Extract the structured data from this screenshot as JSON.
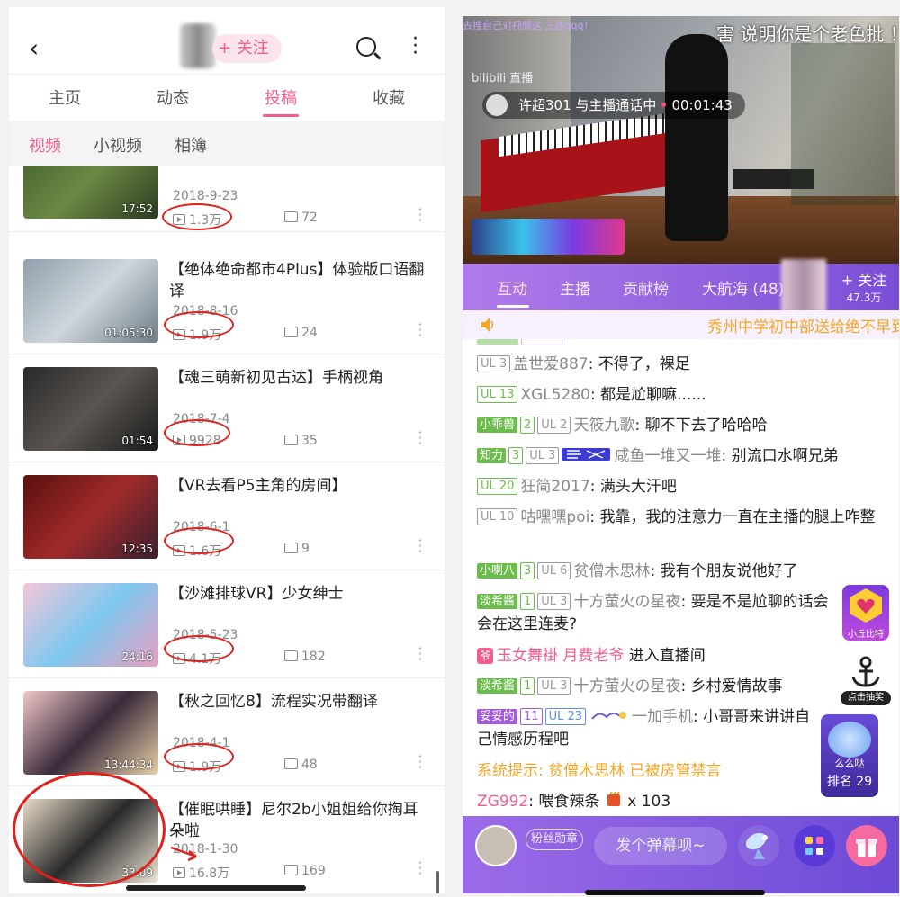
{
  "left": {
    "header": {
      "back": "‹",
      "follow": "+ 关注"
    },
    "tabs": [
      "主页",
      "动态",
      "投稿",
      "收藏"
    ],
    "active_tab": "投稿",
    "subtabs": [
      "视频",
      "小视频",
      "相簿"
    ],
    "active_subtab": "视频",
    "videos": [
      {
        "title": "",
        "date": "2018-9-23",
        "plays": "1.3万",
        "comments": "72",
        "duration": "17:52"
      },
      {
        "title": "【绝体绝命都市4Plus】体验版口语翻译",
        "date": "2018-8-16",
        "plays": "1.9万",
        "comments": "24",
        "duration": "01:05:30"
      },
      {
        "title": "【魂三萌新初见古达】手柄视角",
        "date": "2018-7-4",
        "plays": "9928",
        "comments": "35",
        "duration": "01:54"
      },
      {
        "title": "【VR去看P5主角的房间】",
        "date": "2018-6-1",
        "plays": "1.6万",
        "comments": "9",
        "duration": "12:35"
      },
      {
        "title": "【沙滩排球VR】少女绅士",
        "date": "2018-5-23",
        "plays": "4.1万",
        "comments": "182",
        "duration": "24:16"
      },
      {
        "title": "【秋之回忆8】流程实况带翻译",
        "date": "2018-4-1",
        "plays": "1.9万",
        "comments": "48",
        "duration": "13:44:34"
      },
      {
        "title": "【催眠哄睡】尼尔2b小姐姐给你掏耳朵啦",
        "date": "2018-1-30",
        "plays": "16.8万",
        "comments": "169",
        "duration": "33:09"
      }
    ]
  },
  "right": {
    "video": {
      "top_comment": "害 说明你是个老色批 ！",
      "top_scroll": "去搜自己对视频这 三连qqq！",
      "logo": "bilibili 直播",
      "call_name": "许超301",
      "call_text": "与主播通话中",
      "call_time": "00:01:43"
    },
    "tabs": [
      "互动",
      "主播",
      "贡献榜",
      "大航海 (48)"
    ],
    "active_tab": "互动",
    "follow": {
      "label": "+ 关注",
      "count": "47.3万"
    },
    "notice": "秀州中学初中部送给绝不早到",
    "chat": [
      {
        "tags": [
          {
            "t": "UL 3",
            "c": "ul"
          }
        ],
        "user": "盖世爱887",
        "msg": "不得了，裸足"
      },
      {
        "tags": [
          {
            "t": "UL 13",
            "c": "medal-n"
          }
        ],
        "user": "XGL5280",
        "msg": "都是尬聊嘛......"
      },
      {
        "tags": [
          {
            "t": "小乖兽",
            "c": "medal-g"
          },
          {
            "t": "2",
            "c": "medal-n"
          },
          {
            "t": "UL 2",
            "c": "ul"
          }
        ],
        "user": "天筱九歌",
        "msg": "聊不下去了哈哈哈"
      },
      {
        "tags": [
          {
            "t": "知力",
            "c": "medal-g"
          },
          {
            "t": "3",
            "c": "medal-n"
          },
          {
            "t": "UL 3",
            "c": "ul"
          }
        ],
        "user": "咸鱼一堆又一堆",
        "msg": "别流口水啊兄弟"
      },
      {
        "tags": [
          {
            "t": "UL 20",
            "c": "medal-n"
          }
        ],
        "user": "狂简2017",
        "msg": "满头大汗吧"
      },
      {
        "tags": [
          {
            "t": "UL 10",
            "c": "ul"
          }
        ],
        "user": "咕嘿嘿poi",
        "msg": "我靠，我的注意力一直在主播的腿上咋整"
      },
      {
        "tags": [
          {
            "t": "小喇八",
            "c": "medal-g"
          },
          {
            "t": "3",
            "c": "medal-n"
          },
          {
            "t": "UL 6",
            "c": "ul"
          }
        ],
        "user": "贫僧木思林",
        "msg": "我有个朋友说他好了"
      },
      {
        "tags": [
          {
            "t": "淡希酱",
            "c": "medal-g"
          },
          {
            "t": "1",
            "c": "medal-n"
          },
          {
            "t": "UL 3",
            "c": "ul"
          }
        ],
        "user": "十方萤火の星夜",
        "msg": "要是不是尬聊的话会会在这里连麦?"
      },
      {
        "enter": true,
        "ye": "爷",
        "user": "玉女舞褂",
        "role": "月费老爷",
        "msg": "进入直播间"
      },
      {
        "tags": [
          {
            "t": "淡希酱",
            "c": "medal-g"
          },
          {
            "t": "1",
            "c": "medal-n"
          },
          {
            "t": "UL 3",
            "c": "ul"
          }
        ],
        "user": "十方萤火の星夜",
        "msg": "乡村爱情故事"
      },
      {
        "tags": [
          {
            "t": "妥妥的",
            "c": "medal-p"
          },
          {
            "t": "11",
            "c": "medal-pn"
          },
          {
            "t": "UL 23",
            "c": "ul blue"
          }
        ],
        "user": "一加手机",
        "msg": "小哥哥来讲讲自己情感历程吧"
      },
      {
        "system": true,
        "text": "系统提示: 贫僧木思林 已被房管禁言"
      },
      {
        "gift": true,
        "user": "ZG992",
        "msg": "喂食辣条",
        "count": "x 103"
      }
    ],
    "side": {
      "xiaoqiu": "小丘比特",
      "lottery": "点击抽奖",
      "rank_name": "么么哒",
      "rank": "排名 29"
    },
    "bottom": {
      "medal": "粉丝勋章",
      "placeholder": "发个弹幕呗~"
    }
  }
}
